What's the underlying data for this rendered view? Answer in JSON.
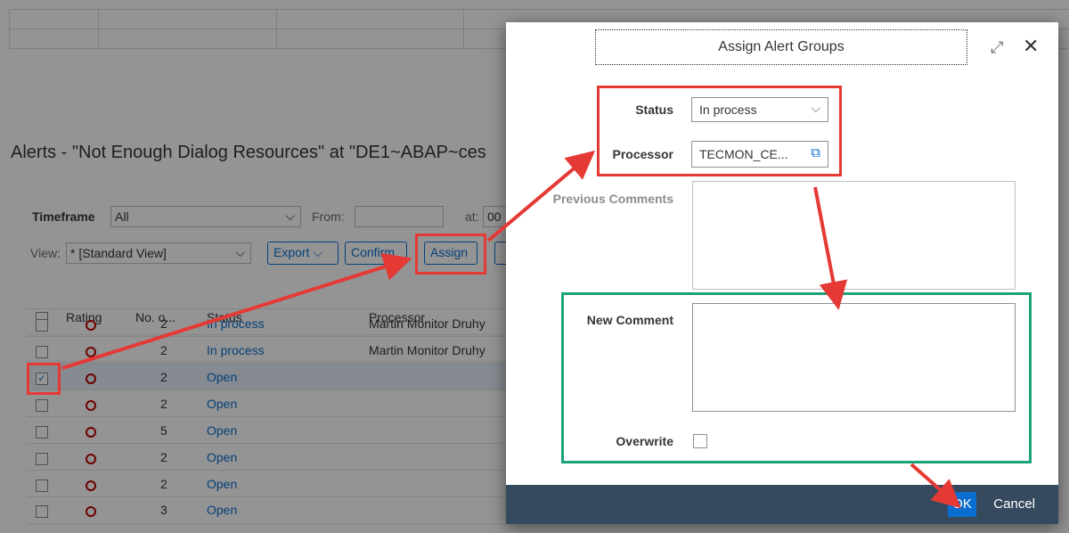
{
  "background": {
    "alerts_title": "Alerts -  \"Not Enough Dialog Resources\" at \"DE1~ABAP~ces",
    "timeframe_label": "Timeframe",
    "timeframe_value": "All",
    "from_label": "From:",
    "at_label": "at:",
    "at_value": "00",
    "view_label": "View:",
    "view_value": "* [Standard View]",
    "export_label": "Export",
    "confirm_label": "Confirm",
    "assign_label": "Assign",
    "columns": [
      "Rating",
      "No. o...",
      "Status",
      "Processor"
    ],
    "rows": [
      {
        "count": "2",
        "status": "In process",
        "processor": "Martin Monitor Druhy",
        "checked": false
      },
      {
        "count": "2",
        "status": "In process",
        "processor": "Martin Monitor Druhy",
        "checked": false
      },
      {
        "count": "2",
        "status": "Open",
        "processor": "",
        "checked": true
      },
      {
        "count": "2",
        "status": "Open",
        "processor": "",
        "checked": false
      },
      {
        "count": "5",
        "status": "Open",
        "processor": "",
        "checked": false
      },
      {
        "count": "2",
        "status": "Open",
        "processor": "",
        "checked": false
      },
      {
        "count": "2",
        "status": "Open",
        "processor": "",
        "checked": false
      },
      {
        "count": "3",
        "status": "Open",
        "processor": "",
        "checked": false
      }
    ]
  },
  "dialog": {
    "title": "Assign Alert Groups",
    "status_label": "Status",
    "status_value": "In process",
    "processor_label": "Processor",
    "processor_value": "TECMON_CE...",
    "previous_comments_label": "Previous Comments",
    "new_comment_label": "New Comment",
    "overwrite_label": "Overwrite",
    "ok_label": "OK",
    "cancel_label": "Cancel"
  },
  "colors": {
    "brand_blue": "#0a6ed1",
    "footer_bg": "#354a5f",
    "annotation_red": "#e53935",
    "annotation_green": "#1aa37a",
    "rating_red": "#bb0000"
  },
  "icons": [
    "resize-icon",
    "close-icon",
    "chevron-down-icon",
    "value-help-icon",
    "checkbox-icon",
    "rating-circle-icon"
  ]
}
